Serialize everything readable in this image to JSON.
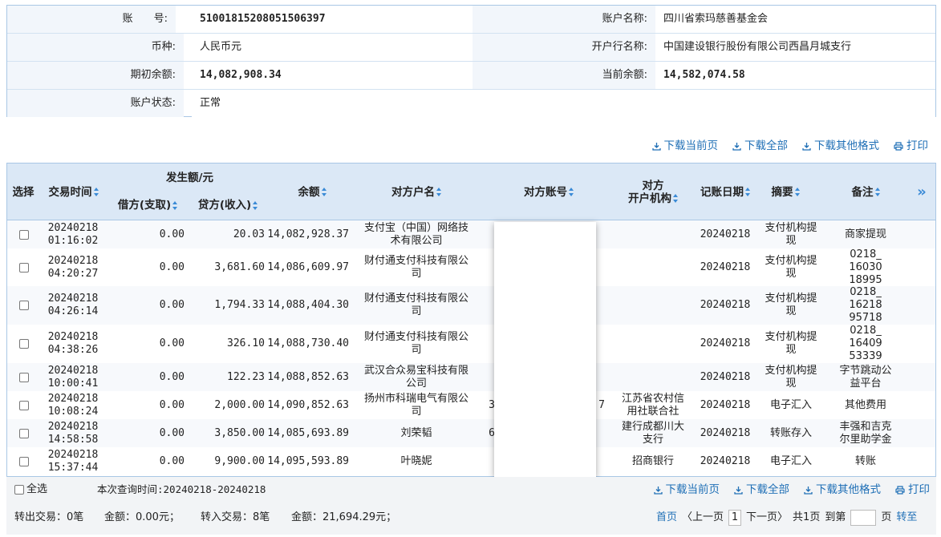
{
  "account_info": {
    "account_no_label": "账　　号:",
    "account_no": "510018152080515063",
    "account_no_tail": "97",
    "account_name_label": "账户名称:",
    "account_name": "四川省索玛慈善基金会",
    "currency_label": "币种:",
    "currency": "人民币元",
    "bank_label": "开户行名称:",
    "bank": "中国建设银行股份有限公司西昌月城支行",
    "opening_balance_label": "期初余额:",
    "opening_balance": "14,082,908.34",
    "current_balance_label": "当前余额:",
    "current_balance": "14,582,074.58",
    "status_label": "账户状态:",
    "status": "正常"
  },
  "actions": {
    "download_page": "下载当前页",
    "download_all": "下载全部",
    "download_other": "下载其他格式",
    "print": "打印"
  },
  "table": {
    "headers": {
      "select": "选择",
      "time": "交易时间",
      "amount_group": "发生额/元",
      "debit": "借方(支取)",
      "credit": "贷方(收入)",
      "balance": "余额",
      "counterparty_name": "对方户名",
      "counterparty_account": "对方账号",
      "counterparty_bank_line1": "对方",
      "counterparty_bank_line2": "开户机构",
      "post_date": "记账日期",
      "summary": "摘要",
      "remark": "备注",
      "more": "»"
    },
    "rows": [
      {
        "date": "20240218",
        "time": "01:16:02",
        "debit": "0.00",
        "credit": "20.03",
        "balance": "14,082,928.37",
        "name1": "支付宝（中国）网络技",
        "name2": "术有限公司",
        "acct": "",
        "bank1": "",
        "bank2": "",
        "post": "20240218",
        "sum1": "支付机构提",
        "sum2": "现",
        "rem1": "商家提现",
        "rem2": "",
        "rem3": ""
      },
      {
        "date": "20240218",
        "time": "04:20:27",
        "debit": "0.00",
        "credit": "3,681.60",
        "balance": "14,086,609.97",
        "name1": "财付通支付科技有限公",
        "name2": "司",
        "acct": "",
        "bank1": "",
        "bank2": "",
        "post": "20240218",
        "sum1": "支付机构提",
        "sum2": "现",
        "rem1": "0218_",
        "rem2": "16030",
        "rem3": "18995"
      },
      {
        "date": "20240218",
        "time": "04:26:14",
        "debit": "0.00",
        "credit": "1,794.33",
        "balance": "14,088,404.30",
        "name1": "财付通支付科技有限公",
        "name2": "司",
        "acct": "",
        "bank1": "",
        "bank2": "",
        "post": "20240218",
        "sum1": "支付机构提",
        "sum2": "现",
        "rem1": "0218_",
        "rem2": "16218",
        "rem3": "95718"
      },
      {
        "date": "20240218",
        "time": "04:38:26",
        "debit": "0.00",
        "credit": "326.10",
        "balance": "14,088,730.40",
        "name1": "财付通支付科技有限公",
        "name2": "司",
        "acct": "",
        "bank1": "",
        "bank2": "",
        "post": "20240218",
        "sum1": "支付机构提",
        "sum2": "现",
        "rem1": "0218_",
        "rem2": "16409",
        "rem3": "53339"
      },
      {
        "date": "20240218",
        "time": "10:00:41",
        "debit": "0.00",
        "credit": "122.23",
        "balance": "14,088,852.63",
        "name1": "武汉合众易宝科技有限",
        "name2": "公司",
        "acct": "",
        "bank1": "",
        "bank2": "",
        "post": "20240218",
        "sum1": "支付机构提",
        "sum2": "现",
        "rem1": "字节跳动公",
        "rem2": "益平台",
        "rem3": ""
      },
      {
        "date": "20240218",
        "time": "10:08:24",
        "debit": "0.00",
        "credit": "2,000.00",
        "balance": "14,090,852.63",
        "name1": "扬州市科瑞电气有限公",
        "name2": "司",
        "acct": "3",
        "acct_tail": "7",
        "bank1": "江苏省农村信",
        "bank2": "用社联合社",
        "post": "20240218",
        "sum1": "电子汇入",
        "sum2": "",
        "rem1": "其他费用",
        "rem2": "",
        "rem3": ""
      },
      {
        "date": "20240218",
        "time": "14:58:58",
        "debit": "0.00",
        "credit": "3,850.00",
        "balance": "14,085,693.89",
        "name1": "刘荣韬",
        "name2": "",
        "acct": "6",
        "acct_tail": "",
        "bank1": "建行成都川大",
        "bank2": "支行",
        "post": "20240218",
        "sum1": "转账存入",
        "sum2": "",
        "rem1": "丰强和吉克",
        "rem2": "尔里助学金",
        "rem3": ""
      },
      {
        "date": "20240218",
        "time": "15:37:44",
        "debit": "0.00",
        "credit": "9,900.00",
        "balance": "14,095,593.89",
        "name1": "叶晓妮",
        "name2": "",
        "acct": "",
        "acct_tail": "",
        "bank1": "招商银行",
        "bank2": "",
        "post": "20240218",
        "sum1": "电子汇入",
        "sum2": "",
        "rem1": "转账",
        "rem2": "",
        "rem3": ""
      }
    ]
  },
  "footer": {
    "select_all": "全选",
    "query_time": "本次查询时间:20240218-20240218",
    "out_tx": "转出交易：0笔",
    "out_amount": "金额：0.00元；",
    "in_tx": "转入交易：8笔",
    "in_amount": "金额：21,694.29元；",
    "first_page": "首页",
    "prev_page": "〈上一页",
    "current_page": "1",
    "next_page": "下一页〉",
    "total_pages": "共1页",
    "goto_label": "到第",
    "goto_suffix": "页",
    "goto_button": "转至"
  }
}
